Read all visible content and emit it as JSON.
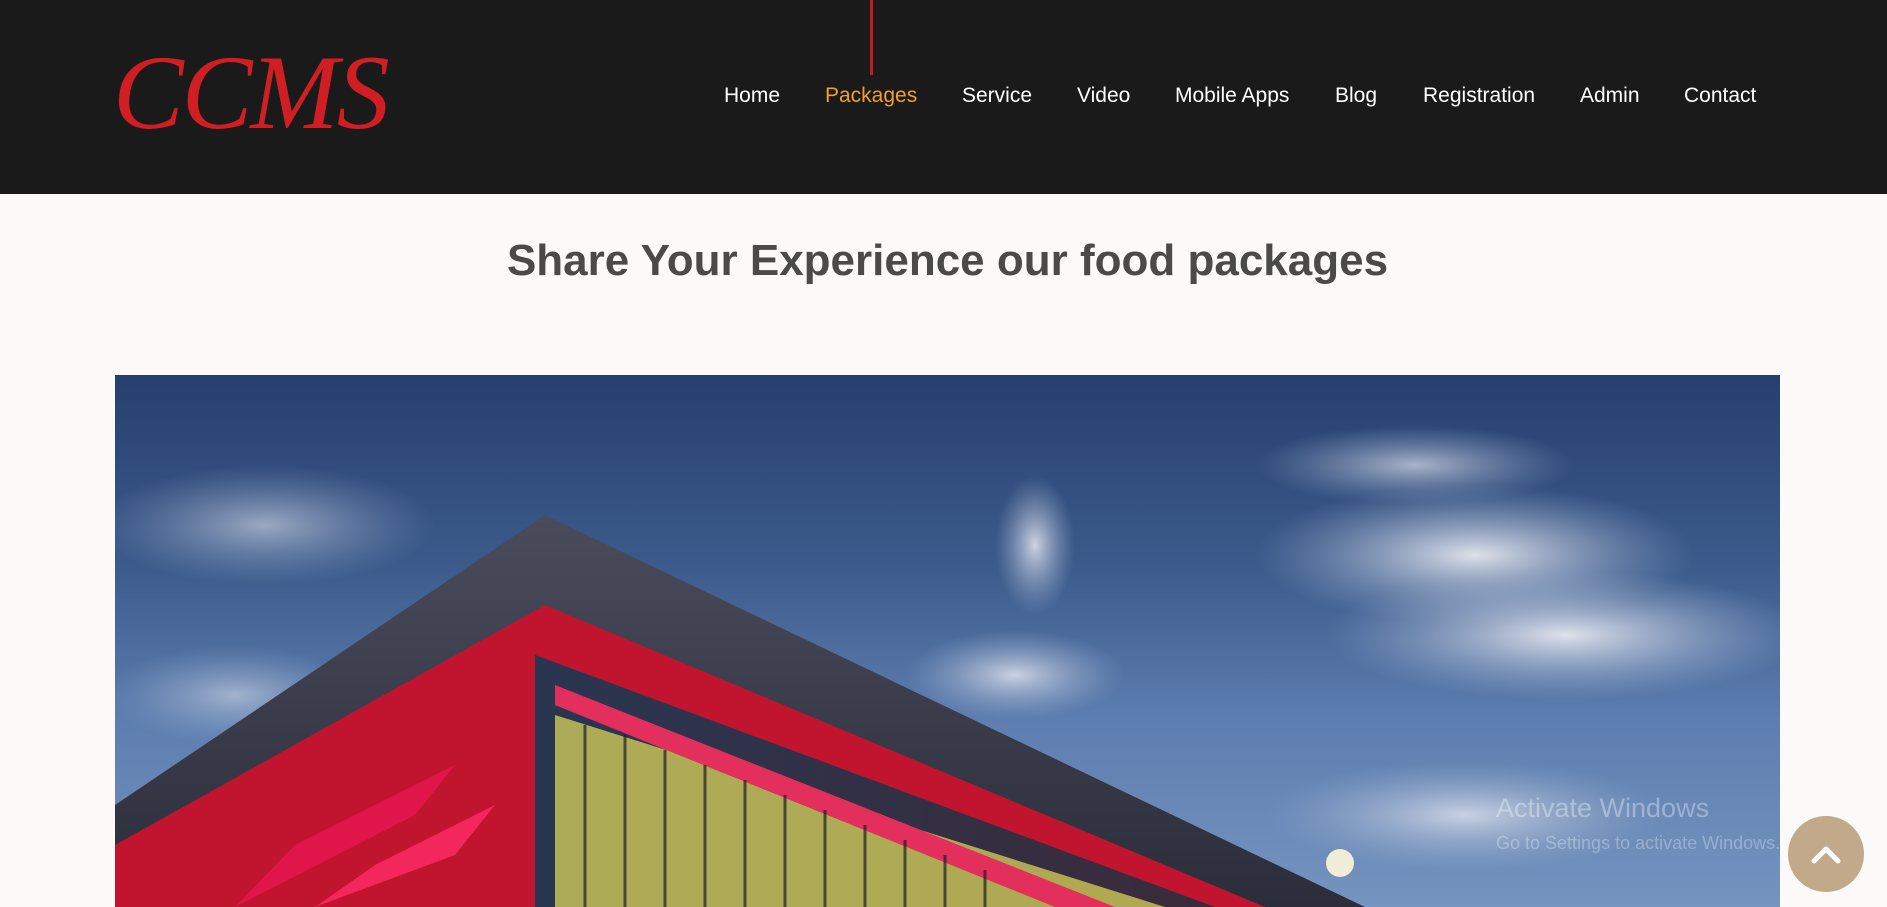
{
  "header": {
    "logo_text": "CCMS",
    "nav": [
      {
        "label": "Home",
        "active": false
      },
      {
        "label": "Packages",
        "active": true
      },
      {
        "label": "Service",
        "active": false
      },
      {
        "label": "Video",
        "active": false
      },
      {
        "label": "Mobile Apps",
        "active": false
      },
      {
        "label": "Blog",
        "active": false
      },
      {
        "label": "Registration",
        "active": false
      },
      {
        "label": "Admin",
        "active": false
      },
      {
        "label": "Contact",
        "active": false
      }
    ]
  },
  "main": {
    "title": "Share Your Experience our food packages"
  },
  "overlay": {
    "watermark": "Activate Windows",
    "watermark_sub": "Go to Settings to activate Windows."
  },
  "colors": {
    "header_bg": "#1a1a1a",
    "logo": "#cf1f22",
    "nav_text": "#ffffff",
    "nav_active": "#f0a02a",
    "active_indicator": "#c31c1f",
    "title": "#4a4a4a",
    "page_bg": "#fbfaf8",
    "scroll_button": "#bba07c"
  },
  "icons": {
    "scroll_top": "chevron-up-icon"
  }
}
